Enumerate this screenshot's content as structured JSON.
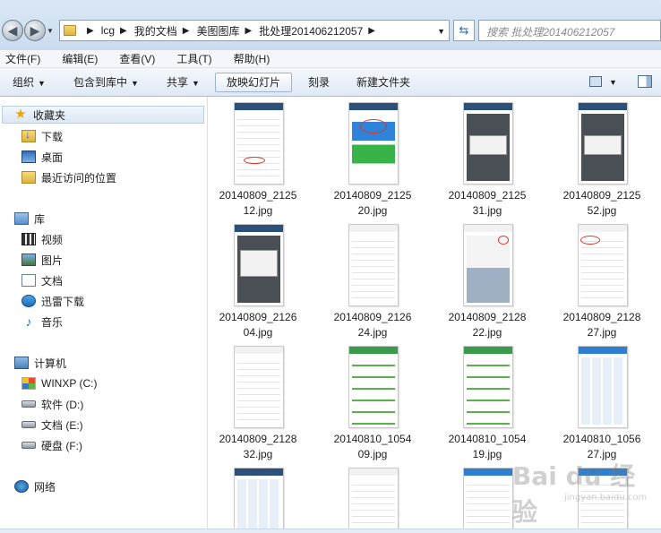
{
  "address": {
    "crumbs": [
      "lcg",
      "我的文档",
      "美图图库",
      "批处理201406212057"
    ],
    "search_placeholder": "搜索 批处理201406212057"
  },
  "menu": [
    "文件(F)",
    "编辑(E)",
    "查看(V)",
    "工具(T)",
    "帮助(H)"
  ],
  "toolbar": {
    "organize": "组织",
    "include_in_library": "包含到库中",
    "share": "共享",
    "slideshow": "放映幻灯片",
    "burn": "刻录",
    "new_folder": "新建文件夹"
  },
  "sidebar": {
    "favorites": "收藏夹",
    "downloads": "下载",
    "desktop": "桌面",
    "recent": "最近访问的位置",
    "libraries": "库",
    "videos": "视频",
    "pictures": "图片",
    "documents": "文档",
    "xunlei": "迅雷下载",
    "music": "音乐",
    "computer": "计算机",
    "drive_c": "WINXP (C:)",
    "drive_d": "软件 (D:)",
    "drive_e": "文档 (E:)",
    "drive_f": "硬盘 (F:)",
    "network": "网络"
  },
  "files": [
    {
      "line1": "20140809_2125",
      "line2": "12.jpg"
    },
    {
      "line1": "20140809_2125",
      "line2": "20.jpg"
    },
    {
      "line1": "20140809_2125",
      "line2": "31.jpg"
    },
    {
      "line1": "20140809_2125",
      "line2": "52.jpg"
    },
    {
      "line1": "20140809_2126",
      "line2": "04.jpg"
    },
    {
      "line1": "20140809_2126",
      "line2": "24.jpg"
    },
    {
      "line1": "20140809_2128",
      "line2": "22.jpg"
    },
    {
      "line1": "20140809_2128",
      "line2": "27.jpg"
    },
    {
      "line1": "20140809_2128",
      "line2": "32.jpg"
    },
    {
      "line1": "20140810_1054",
      "line2": "09.jpg"
    },
    {
      "line1": "20140810_1054",
      "line2": "19.jpg"
    },
    {
      "line1": "20140810_1056",
      "line2": "27.jpg"
    }
  ],
  "watermark": {
    "main": "Bai du 经验",
    "sub": "jingyan.baidu.com"
  }
}
